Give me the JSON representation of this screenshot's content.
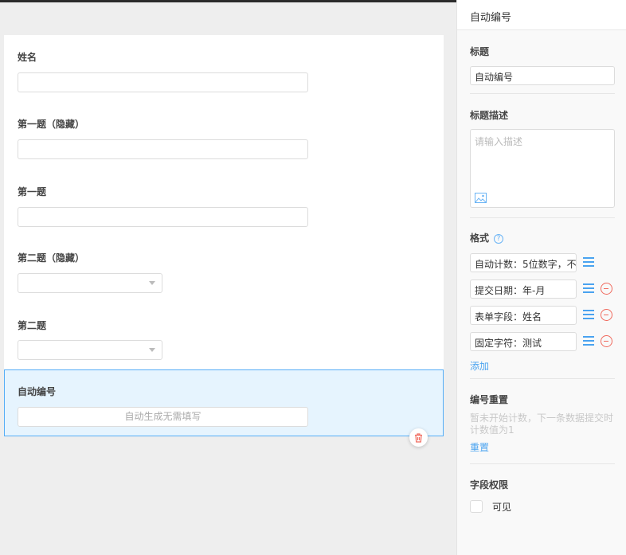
{
  "form": {
    "fields": [
      {
        "label": "姓名",
        "type": "text"
      },
      {
        "label": "第一题（隐藏）",
        "type": "text"
      },
      {
        "label": "第一题",
        "type": "text"
      },
      {
        "label": "第二题（隐藏）",
        "type": "select"
      },
      {
        "label": "第二题",
        "type": "select"
      }
    ],
    "active_field": {
      "label": "自动编号",
      "placeholder": "自动生成无需填写"
    }
  },
  "panel": {
    "header": "自动编号",
    "title_label": "标题",
    "title_value": "自动编号",
    "desc_label": "标题描述",
    "desc_placeholder": "请输入描述",
    "format_label": "格式",
    "format_rows": [
      "自动计数：5位数字，不",
      "提交日期：年-月",
      "表单字段：姓名",
      "固定字符：测试"
    ],
    "add_label": "添加",
    "reset_title": "编号重置",
    "reset_hint": "暂未开始计数，下一条数据提交时计数值为1",
    "reset_link": "重置",
    "perm_title": "字段权限",
    "visible_label": "可见"
  },
  "colors": {
    "accent": "#4aa3f0",
    "danger": "#f06a5e",
    "active_bg": "#e6f4fe"
  }
}
